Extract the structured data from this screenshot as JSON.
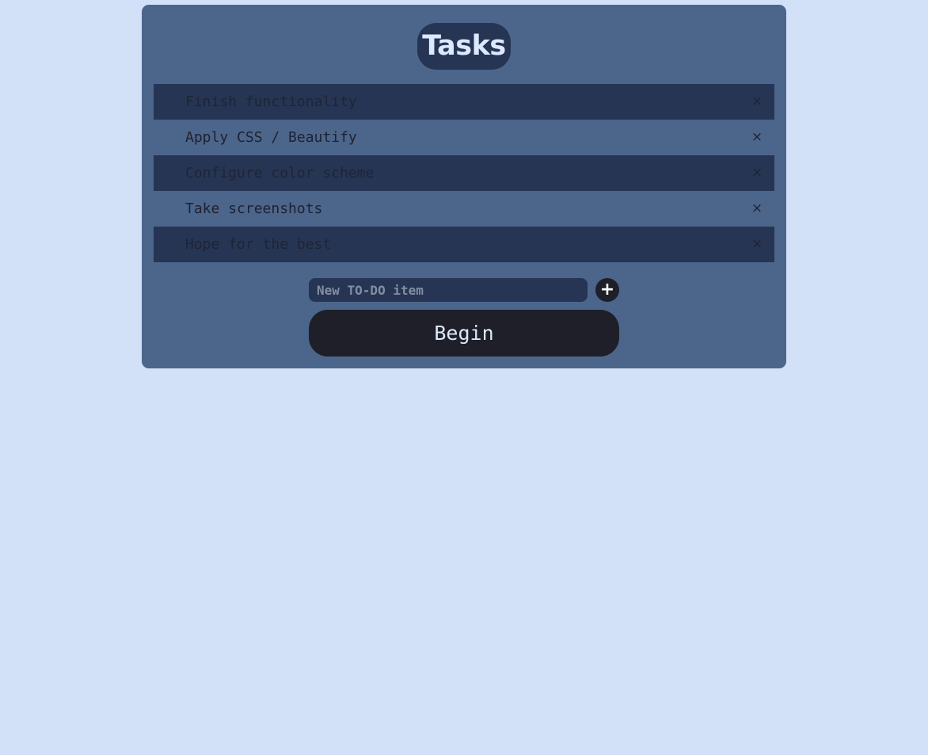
{
  "header": {
    "title": "Tasks"
  },
  "tasks": [
    {
      "label": "Finish functionality",
      "remove_glyph": "×"
    },
    {
      "label": "Apply CSS / Beautify",
      "remove_glyph": "×"
    },
    {
      "label": "Configure color scheme",
      "remove_glyph": "×"
    },
    {
      "label": "Take screenshots",
      "remove_glyph": "×"
    },
    {
      "label": "Hope for the best",
      "remove_glyph": "×"
    }
  ],
  "new_item": {
    "value": "",
    "placeholder": "New TO-DO item",
    "add_label": "+"
  },
  "actions": {
    "begin_label": "Begin"
  },
  "colors": {
    "page_background": "#d2e1f8",
    "card_background": "#4c658b",
    "row_dark": "#263554",
    "button_dark": "#1e1f28",
    "accent_text": "#dce9ff"
  },
  "icons": {
    "remove": "close-icon",
    "add": "plus-icon"
  }
}
